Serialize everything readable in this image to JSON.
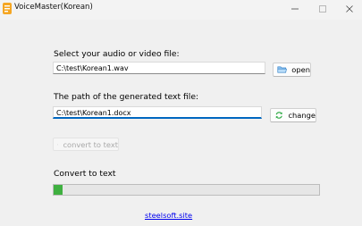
{
  "window": {
    "title": "VoiceMaster(Korean)",
    "app_icon": "app-logo-icon",
    "controls": [
      "minimize-icon",
      "maximize-icon",
      "close-icon"
    ]
  },
  "input_section": {
    "label": "Select your audio or video file:",
    "path": "C:\\test\\Korean1.wav",
    "button_label": "open",
    "button_icon": "folder-icon"
  },
  "output_section": {
    "label": "The path of the generated text file:",
    "path": "C:\\test\\Korean1.docx",
    "button_label": "change",
    "button_icon": "refresh-icon"
  },
  "convert": {
    "button_label": "convert to text",
    "button_icon": "microphone-convert-icon",
    "enabled": false
  },
  "progress": {
    "label": "Convert to text",
    "value": 0.035,
    "color": "#3fb040"
  },
  "footer": {
    "link": "steelsoft.site",
    "link_color": "#0000ee"
  }
}
